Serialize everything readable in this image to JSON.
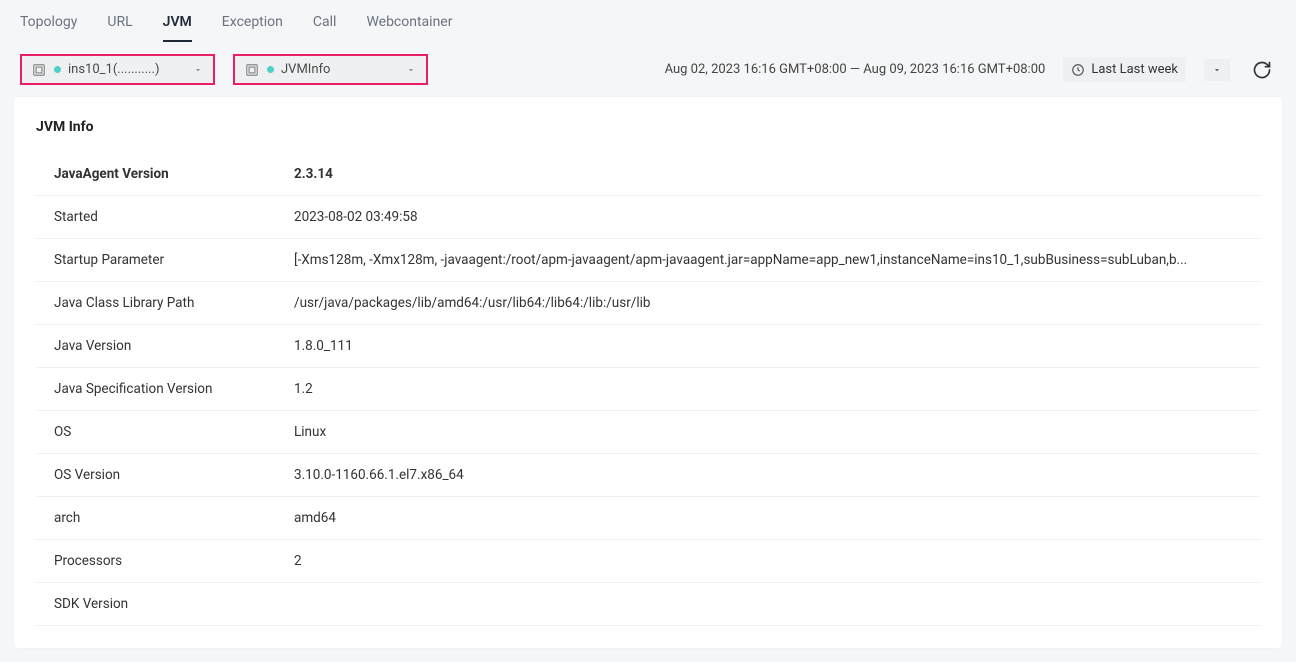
{
  "tabs": {
    "topology": "Topology",
    "url": "URL",
    "jvm": "JVM",
    "exception": "Exception",
    "call": "Call",
    "webcontainer": "Webcontainer"
  },
  "filters": {
    "instance": "ins10_1(...........)",
    "metric": "JVMInfo"
  },
  "time": {
    "range_text": "Aug 02, 2023 16:16 GMT+08:00 — Aug 09, 2023 16:16 GMT+08:00",
    "picker_label": "Last Last week"
  },
  "card": {
    "title": "JVM Info",
    "rows": [
      {
        "label": "JavaAgent Version",
        "value": "2.3.14",
        "header": true
      },
      {
        "label": "Started",
        "value": "2023-08-02 03:49:58"
      },
      {
        "label": "Startup Parameter",
        "value": "[-Xms128m, -Xmx128m, -javaagent:/root/apm-javaagent/apm-javaagent.jar=appName=app_new1,instanceName=ins10_1,subBusiness=subLuban,b..."
      },
      {
        "label": "Java Class Library Path",
        "value": "/usr/java/packages/lib/amd64:/usr/lib64:/lib64:/lib:/usr/lib"
      },
      {
        "label": "Java Version",
        "value": "1.8.0_111"
      },
      {
        "label": "Java Specification Version",
        "value": "1.2"
      },
      {
        "label": "OS",
        "value": "Linux"
      },
      {
        "label": "OS Version",
        "value": "3.10.0-1160.66.1.el7.x86_64"
      },
      {
        "label": "arch",
        "value": "amd64"
      },
      {
        "label": "Processors",
        "value": "2"
      },
      {
        "label": "SDK Version",
        "value": ""
      }
    ]
  }
}
